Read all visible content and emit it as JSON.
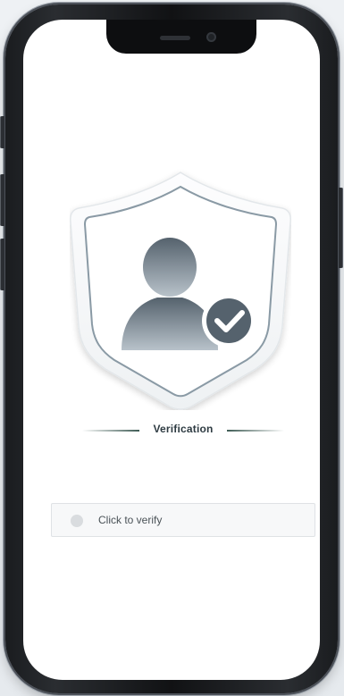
{
  "verification": {
    "title": "Verification"
  },
  "verify_button": {
    "label": "Click to verify"
  },
  "icons": {
    "shield": "shield-user-check-icon",
    "check": "check-circle-icon",
    "radio": "radio-dot-icon"
  },
  "colors": {
    "accent": "#3f5c55",
    "shield_outline": "#8a9aa5",
    "figure": "#6a7782"
  }
}
